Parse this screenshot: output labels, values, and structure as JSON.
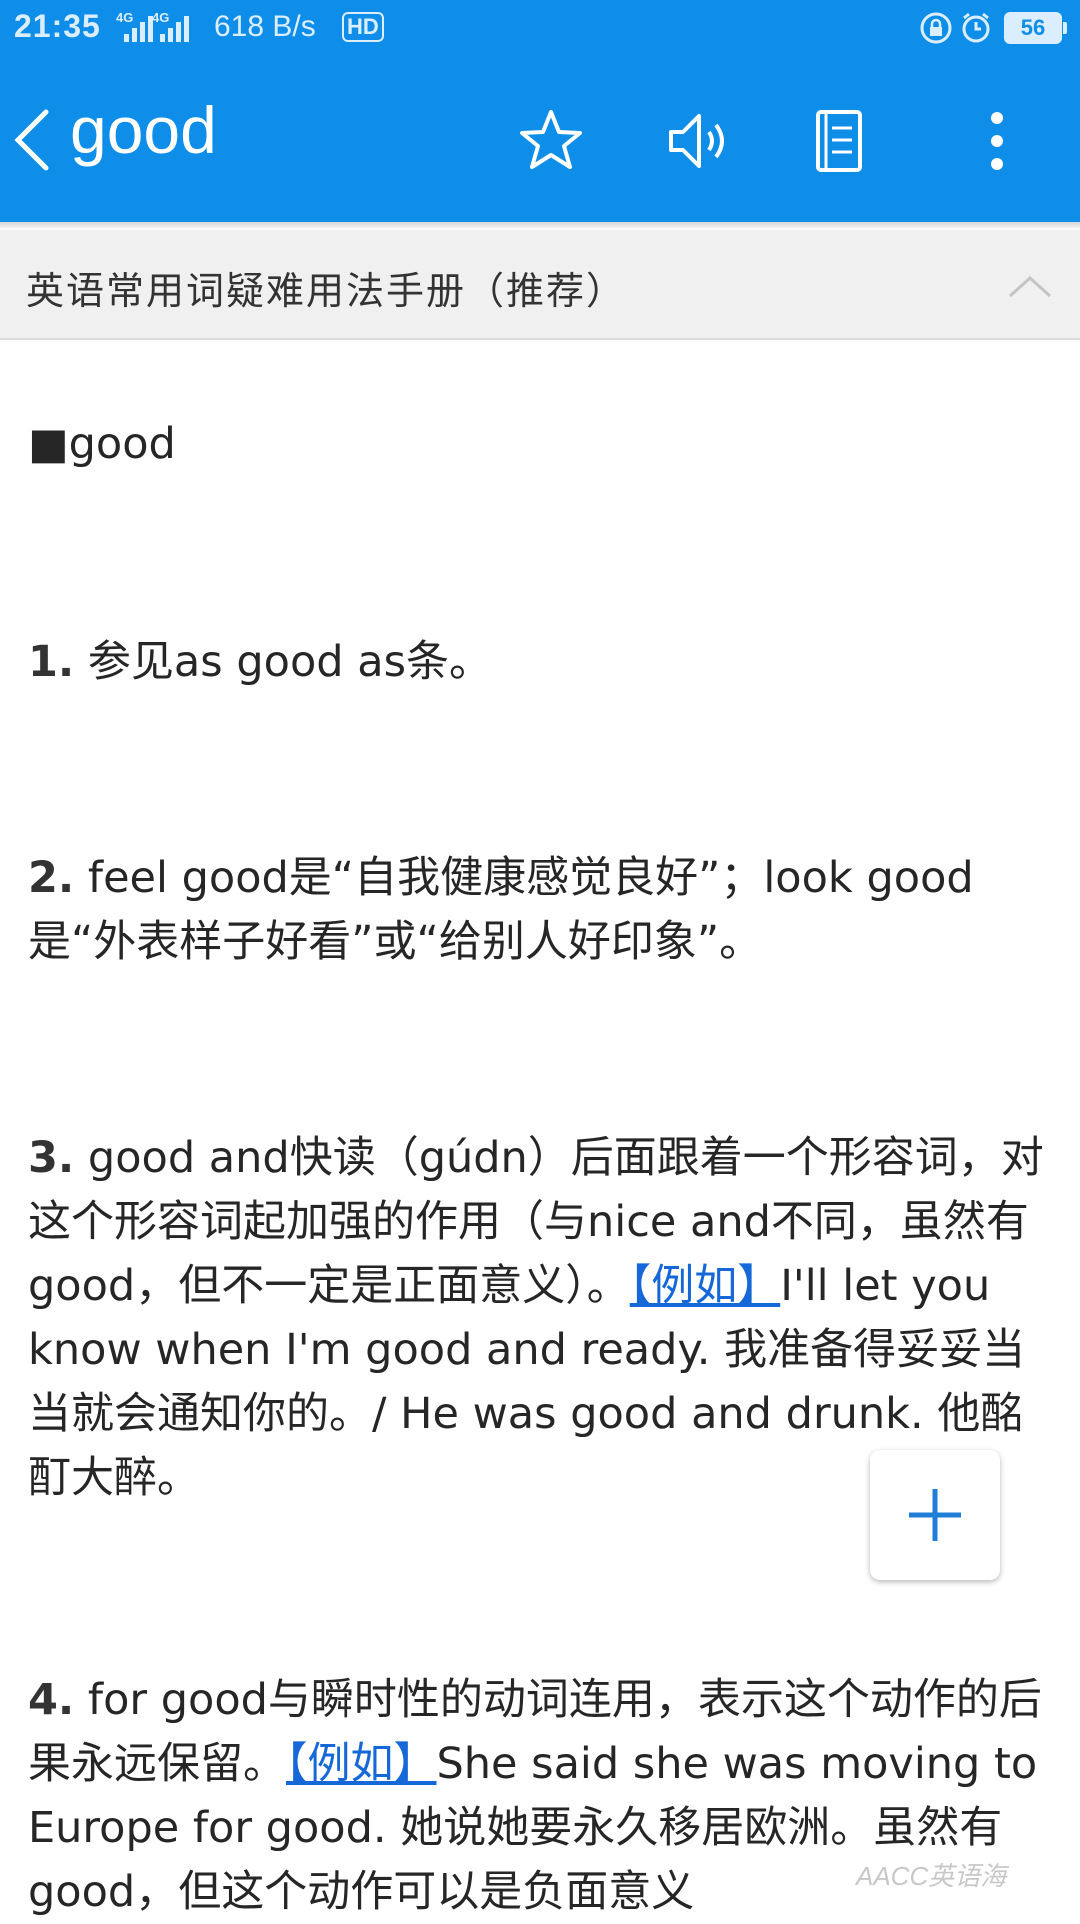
{
  "status_bar": {
    "time": "21:35",
    "network_1": "4G",
    "network_2": "4G",
    "speed": "618 B/s",
    "hd": "HD",
    "battery": "56"
  },
  "header": {
    "word": "good"
  },
  "section": {
    "title": "英语常用词疑难用法手册（推荐）"
  },
  "entry": {
    "headword": "■good",
    "items": [
      {
        "num": "1.",
        "text": " 参见as good as条。"
      },
      {
        "num": "2.",
        "text": " feel good是“自我健康感觉良好”；look good是“外表样子好看”或“给别人好印象”。"
      },
      {
        "num": "3.",
        "text": " good and快读（gúdn）后面跟着一个形容词，对这个形容词起加强的作用（与nice and不同，虽然有good，但不一定是正面意义）。",
        "link": "【例如】",
        "after": "I'll let you know when I'm good and ready. 我准备得妥妥当当就会通知你的。/ He was good and drunk. 他酩酊大醉。"
      },
      {
        "num": "4.",
        "text": " for good与瞬时性的动词连用，表示这个动作的后果永远保留。",
        "link": "【例如】",
        "after": "She said she was moving to Europe for good. 她说她要永久移居欧洲。虽然有good，但这个动作可以是负面意义"
      }
    ]
  },
  "watermark": "AACC英语海",
  "colors": {
    "primary": "#0e8ee9",
    "link": "#1668d8",
    "header_bg": "#f0f0f0"
  },
  "icons": [
    "back-icon",
    "star-icon",
    "speaker-icon",
    "notebook-icon",
    "more-icon",
    "chevron-up-icon",
    "plus-icon"
  ]
}
